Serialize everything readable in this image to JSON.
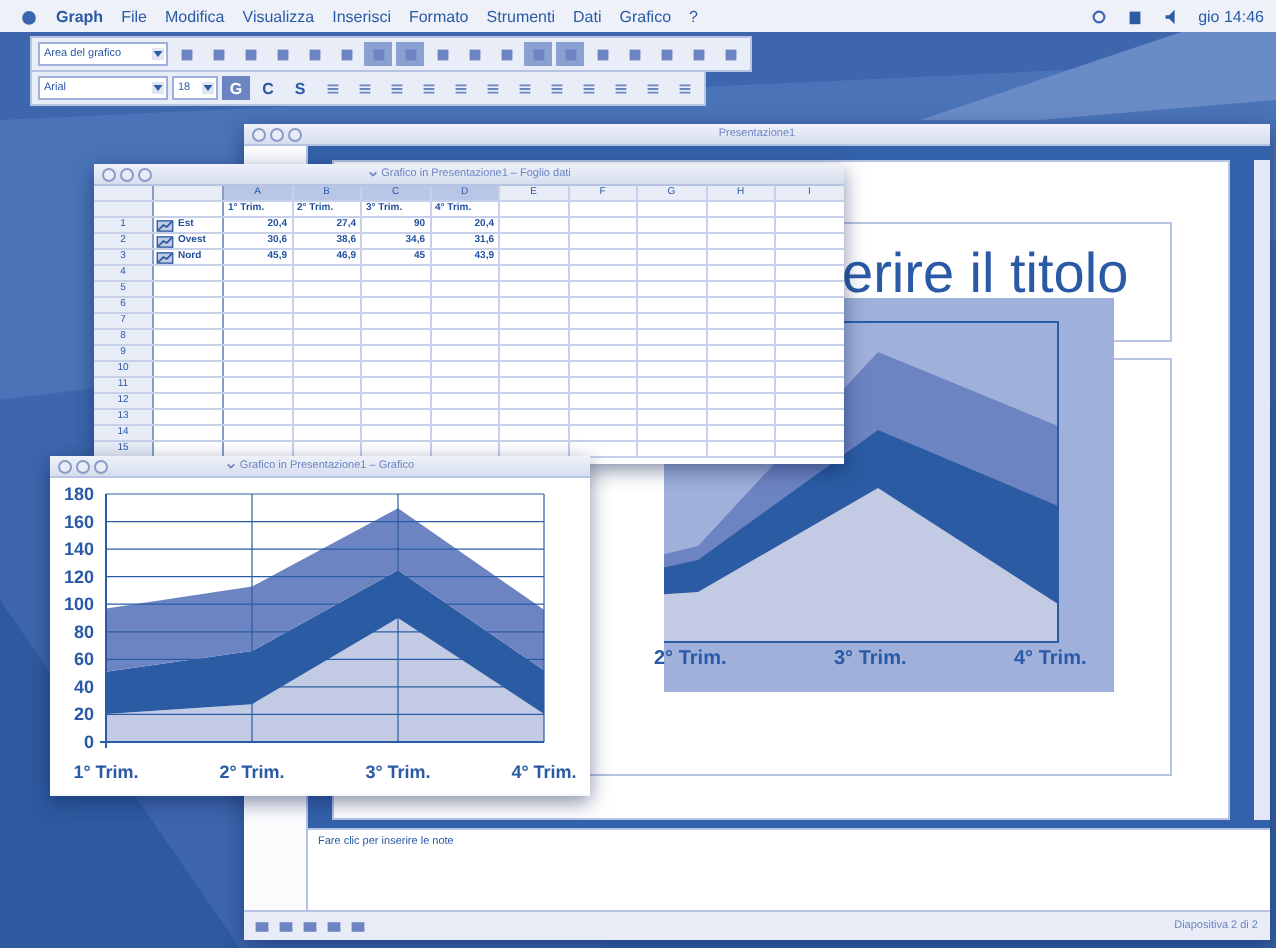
{
  "menu_bar": {
    "items": [
      {
        "label": "Graph",
        "bold": true
      },
      {
        "label": "File",
        "bold": false
      },
      {
        "label": "Modifica",
        "bold": false
      },
      {
        "label": "Visualizza",
        "bold": false
      },
      {
        "label": "Inserisci",
        "bold": false
      },
      {
        "label": "Formato",
        "bold": false
      },
      {
        "label": "Strumenti",
        "bold": false
      },
      {
        "label": "Dati",
        "bold": false
      },
      {
        "label": "Grafico",
        "bold": false
      },
      {
        "label": "?",
        "bold": false
      }
    ],
    "clock": "gio 14:46"
  },
  "toolbar_1": {
    "object_select": "Area del grafico"
  },
  "toolbar_2": {
    "font": "Arial",
    "size": "18",
    "style_buttons": [
      {
        "label": "G",
        "selected": true
      },
      {
        "label": "C",
        "selected": false
      },
      {
        "label": "S",
        "selected": false
      }
    ]
  },
  "presentation_window": {
    "title": "Presentazione1",
    "slide_title": "erire il titolo",
    "slide_chart_labels": [
      "2° Trim.",
      "3° Trim.",
      "4° Trim."
    ],
    "notes_placeholder": "Fare clic per inserire le note",
    "status": "Diapositiva 2 di 2"
  },
  "data_window": {
    "title": "Grafico in Presentazione1 – Foglio dati",
    "columns": [
      "A",
      "B",
      "C",
      "D",
      "E",
      "F",
      "G",
      "H",
      "I"
    ],
    "header_row": [
      "1° Trim.",
      "2° Trim.",
      "3° Trim.",
      "4° Trim."
    ],
    "rows": [
      {
        "number": "1",
        "name": "Est",
        "values": [
          "20,4",
          "27,4",
          "90",
          "20,4"
        ]
      },
      {
        "number": "2",
        "name": "Ovest",
        "values": [
          "30,6",
          "38,6",
          "34,6",
          "31,6"
        ]
      },
      {
        "number": "3",
        "name": "Nord",
        "values": [
          "45,9",
          "46,9",
          "45",
          "43,9"
        ]
      }
    ],
    "empty_rows": [
      "4",
      "5",
      "6",
      "7",
      "8",
      "9",
      "10",
      "11",
      "12",
      "13",
      "14",
      "15"
    ]
  },
  "chart_window": {
    "title": "Grafico in Presentazione1 – Grafico",
    "chart_data": {
      "type": "area",
      "stacked": true,
      "grid": true,
      "categories": [
        "1° Trim.",
        "2° Trim.",
        "3° Trim.",
        "4° Trim."
      ],
      "ylim": [
        0,
        180
      ],
      "yticks": [
        0,
        20,
        40,
        60,
        80,
        100,
        120,
        140,
        160,
        180
      ],
      "series": [
        {
          "color": "#c3cbe4",
          "values": [
            20.4,
            27.4,
            90,
            20.4
          ]
        },
        {
          "color": "#2b5ca3",
          "values": [
            30.6,
            38.6,
            34.6,
            31.6
          ]
        },
        {
          "color": "#6d84c2",
          "values": [
            45.9,
            46.9,
            45,
            43.9
          ]
        }
      ]
    }
  }
}
